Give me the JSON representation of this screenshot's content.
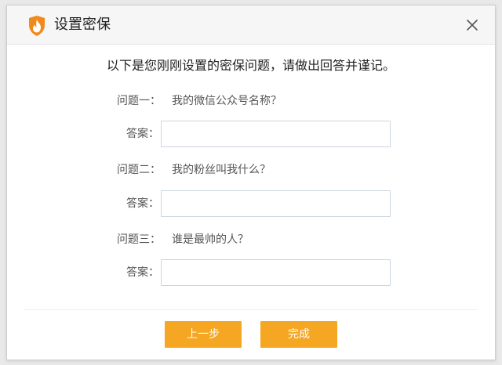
{
  "window": {
    "title": "设置密保",
    "close_icon": "close-icon",
    "logo_icon": "flame-shield-logo"
  },
  "headline": "以下是您刚刚设置的密保问题，请做出回答并谨记。",
  "questions": [
    {
      "label": "问题一：",
      "text": "我的微信公众号名称？",
      "answer_label": "答案：",
      "answer_value": ""
    },
    {
      "label": "问题二：",
      "text": "我的粉丝叫我什么？",
      "answer_label": "答案：",
      "answer_value": ""
    },
    {
      "label": "问题三：",
      "text": "谁是最帅的人？",
      "answer_label": "答案：",
      "answer_value": ""
    }
  ],
  "buttons": {
    "previous": "上一步",
    "finish": "完成"
  },
  "colors": {
    "accent": "#f5a623",
    "input_border": "#cdd5e0",
    "title_bar": "#f6f6f6"
  }
}
